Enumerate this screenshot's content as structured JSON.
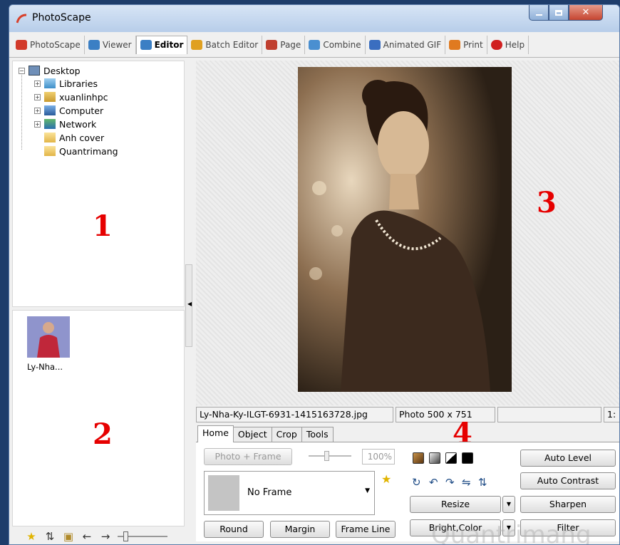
{
  "window": {
    "title": "PhotoScape"
  },
  "main_tabs": [
    {
      "label": "PhotoScape",
      "color": "#d23a2a"
    },
    {
      "label": "Viewer",
      "color": "#3b7fc4"
    },
    {
      "label": "Editor",
      "color": "#3b7fc4"
    },
    {
      "label": "Batch Editor",
      "color": "#e0a020"
    },
    {
      "label": "Page",
      "color": "#c04030"
    },
    {
      "label": "Combine",
      "color": "#4a8fd0"
    },
    {
      "label": "Animated GIF",
      "color": "#3a6ec0"
    },
    {
      "label": "Print",
      "color": "#e07a20"
    },
    {
      "label": "Help",
      "color": "#d02020"
    }
  ],
  "tree": {
    "root": "Desktop",
    "items": [
      "Libraries",
      "xuanlinhpc",
      "Computer",
      "Network",
      "Anh cover",
      "Quantrimang"
    ]
  },
  "labels": {
    "n1": "1",
    "n2": "2",
    "n3": "3",
    "n4": "4"
  },
  "thumbnail": {
    "label": "Ly-Nha..."
  },
  "status": {
    "filename": "Ly-Nha-Ky-ILGT-6931-1415163728.jpg",
    "dimensions": "Photo 500 x 751",
    "extra": "",
    "zoom": "1:"
  },
  "editor_tabs": [
    "Home",
    "Object",
    "Crop",
    "Tools"
  ],
  "home": {
    "photo_frame": "Photo + Frame",
    "percent": "100%",
    "frame_name": "No Frame",
    "round": "Round",
    "margin": "Margin",
    "frame_line": "Frame Line",
    "resize": "Resize",
    "bright_color": "Bright,Color",
    "auto_level": "Auto Level",
    "auto_contrast": "Auto Contrast",
    "sharpen": "Sharpen",
    "filter": "Filter"
  },
  "watermark": "Quantrimang"
}
